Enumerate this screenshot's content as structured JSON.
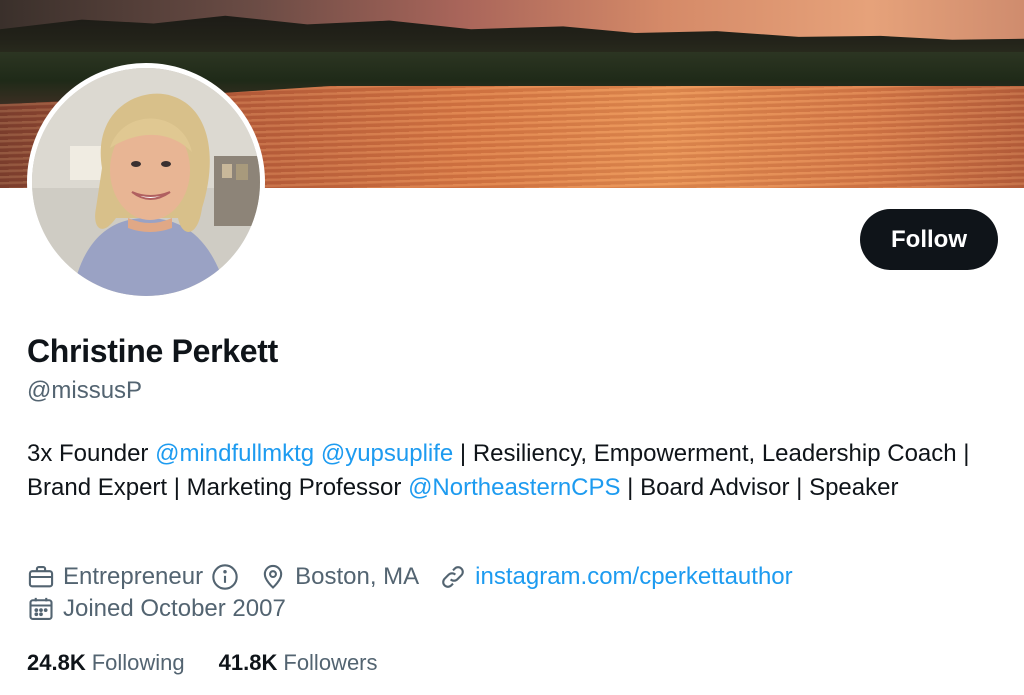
{
  "profile": {
    "name": "Christine Perkett",
    "handle": "@missusP",
    "follow_label": "Follow"
  },
  "bio": {
    "prefix": "3x Founder ",
    "mention_1": "@mindfullmktg",
    "space": " ",
    "mention_2": "@yupsuplife",
    "middle": " | Resiliency, Empowerment, Leadership Coach | Brand Expert | Marketing Professor ",
    "mention_3": "@NortheasternCPS",
    "suffix": " | Board Advisor | Speaker"
  },
  "meta": {
    "category": "Entrepreneur",
    "location": "Boston, MA",
    "website": "instagram.com/cperkettauthor",
    "joined": "Joined October 2007"
  },
  "stats": {
    "following_count": "24.8K",
    "following_label": "Following",
    "followers_count": "41.8K",
    "followers_label": "Followers"
  },
  "colors": {
    "link": "#1d9bf0",
    "text_primary": "#0f1419",
    "text_secondary": "#536471",
    "button_bg": "#0f1419"
  },
  "icons": {
    "category": "briefcase-icon",
    "info": "info-icon",
    "location": "map-pin-icon",
    "website": "link-icon",
    "joined": "calendar-icon"
  }
}
